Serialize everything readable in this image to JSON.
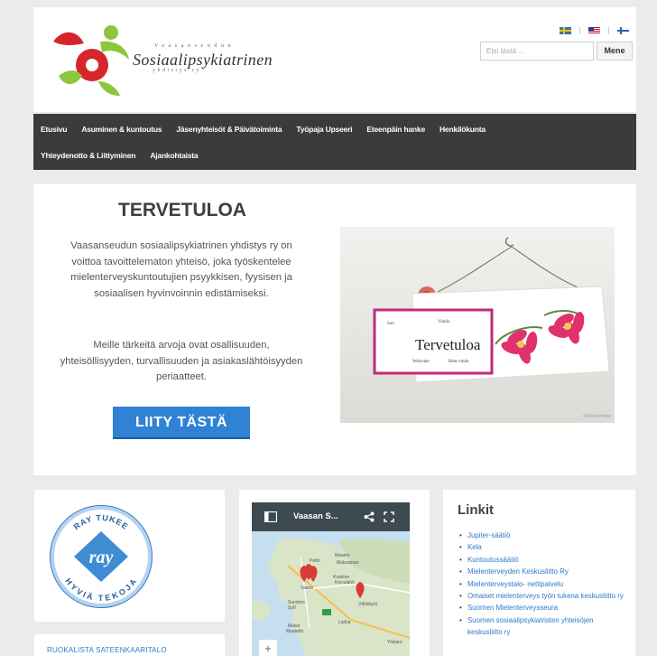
{
  "header": {
    "logo_top": "Vaasanseudun",
    "logo_name": "Sosiaalipsykiatrinen",
    "logo_bottom": "yhdistys ry",
    "search_placeholder": "Etsi tästä ...",
    "search_button": "Mene",
    "languages": [
      "Svenska",
      "English",
      "Suomi"
    ]
  },
  "nav": {
    "row1": [
      "Etusivu",
      "Asuminen & kuntoutus",
      "Jäsenyhteisöt & Päivätoiminta",
      "Työpaja Upseeri",
      "Eteenpäin hanke",
      "Henkilökunta"
    ],
    "row2": [
      "Yhteydenotto & Liittyminen",
      "Ajankohtaista"
    ]
  },
  "welcome": {
    "title": "TERVETULOA",
    "paragraph1": "Vaasanseudun sosiaalipsykiatrinen yhdistys ry on voittoa tavoittelematon yhteisö, joka työskentelee mielenterveyskuntoutujien psyykkisen, fyysisen ja sosiaalisen hyvinvoinnin edistämiseksi.",
    "paragraph2": "Meille tärkeitä arvoja ovat osallisuuden, yhteisöllisyyden, turvallisuuden ja asiakaslähtöisyyden periaatteet.",
    "join_button": "LIITY TÄSTÄ",
    "photo": {
      "sign_main": "Tervetuloa",
      "sign_words": [
        "Soo",
        "Vinkki",
        "Welcome",
        "Bem-vindo"
      ],
      "credit": "©Nona Perkis"
    }
  },
  "ray": {
    "top_text": "RAY TUKEE",
    "center_text": "ray",
    "bottom_text": "HYVIÄ TEKOJA"
  },
  "menu_card": {
    "link": "RUOKALISTA SATEENKAARITALO"
  },
  "map": {
    "title": "Vaasan S...",
    "labels": [
      "Pettri",
      "Maamo",
      "Maksaman",
      "Kvarken",
      "Koivulahti",
      "Vaasa",
      "Vähäkyrö",
      "Sundom",
      "Solf",
      "Malax",
      "Maalahti",
      "Laihia",
      "Ylistaro"
    ],
    "zoom_in": "+"
  },
  "links": {
    "title": "Linkit",
    "items": [
      "Jupiter-säätiö",
      "Kela",
      "Kuntoutussäätiö",
      "Mielenterveyden Keskusliitto Ry",
      "Mielenterveystalo- nettipalvelu",
      "Omaiset mielenterveys työn tukena keskusliitto ry",
      "Suomen Mielenterveysseura",
      "Suomen sosiaalipsykiatristen yhteisöjen keskusliitto ry"
    ]
  }
}
